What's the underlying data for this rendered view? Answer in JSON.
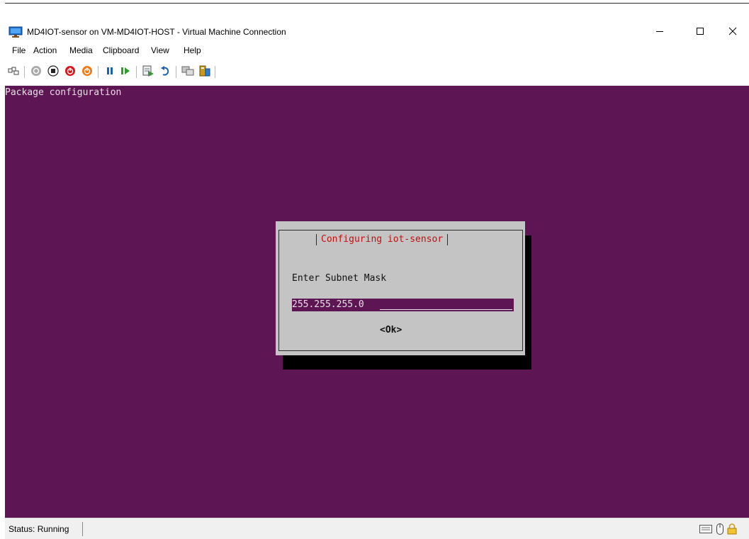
{
  "window": {
    "title": "MD4IOT-sensor on VM-MD4IOT-HOST - Virtual Machine Connection",
    "app_icon": "vm-monitor-icon",
    "controls": {
      "minimize_icon": "minimize-icon",
      "maximize_icon": "maximize-icon",
      "close_icon": "close-icon"
    }
  },
  "menu": {
    "items": [
      {
        "label": "File"
      },
      {
        "label": "Action"
      },
      {
        "label": "Media"
      },
      {
        "label": "Clipboard"
      },
      {
        "label": "View"
      },
      {
        "label": "Help"
      }
    ]
  },
  "toolbar": {
    "buttons": [
      {
        "name": "ctrl-alt-del-button",
        "icon": "ctrl-alt-del-icon"
      },
      {
        "name": "start-button",
        "icon": "start-icon",
        "color": "#9a9a9a"
      },
      {
        "name": "turn-off-button",
        "icon": "stop-icon",
        "color": "#222222"
      },
      {
        "name": "shut-down-button",
        "icon": "shutdown-icon",
        "color": "#d8131a"
      },
      {
        "name": "save-button",
        "icon": "save-state-icon",
        "color": "#f07a13"
      },
      {
        "name": "pause-button",
        "icon": "pause-icon",
        "color": "#1a5fb4"
      },
      {
        "name": "resume-button",
        "icon": "resume-icon",
        "color": "#2a9d2a"
      },
      {
        "name": "checkpoint-button",
        "icon": "checkpoint-icon",
        "color": "#3c8f3c"
      },
      {
        "name": "revert-button",
        "icon": "revert-icon",
        "color": "#1a5fb4"
      },
      {
        "name": "enhanced-session-button",
        "icon": "enhanced-session-icon",
        "color": "#6b6b6b"
      },
      {
        "name": "share-button",
        "icon": "share-icon",
        "color": "#c99a1c"
      }
    ]
  },
  "console": {
    "header": "Package configuration",
    "background": "#5e1553"
  },
  "dialog": {
    "title": "Configuring iot-sensor",
    "title_color": "#c40e0e",
    "prompt": "Enter Subnet Mask",
    "input_value": "255.255.255.0",
    "ok_label": "<Ok>"
  },
  "status": {
    "text": "Status: Running",
    "icons": [
      "keyboard-icon",
      "mouse-icon",
      "lock-icon"
    ]
  }
}
